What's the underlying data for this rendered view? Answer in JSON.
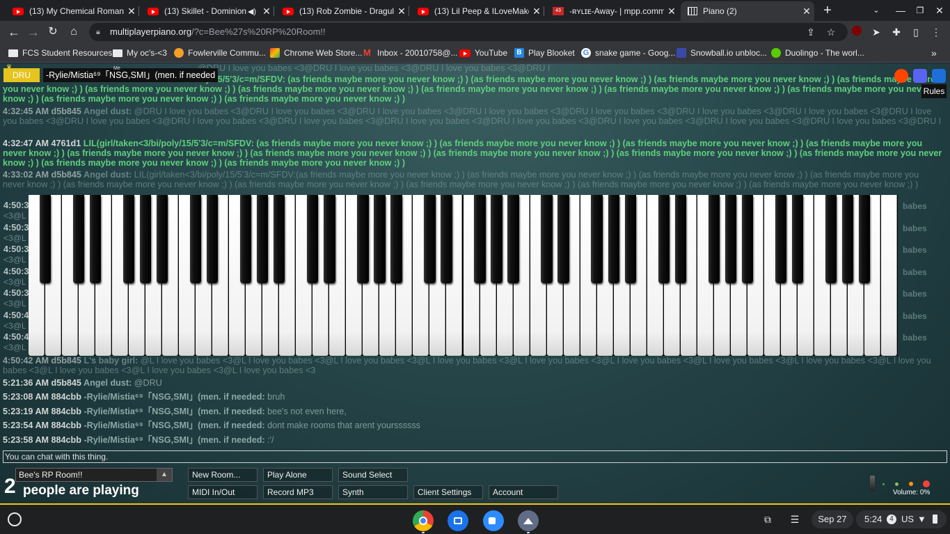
{
  "tabs": [
    {
      "title": "(13) My Chemical Romance",
      "icon": "youtube-icon"
    },
    {
      "title": "(13) Skillet - Dominion [",
      "icon": "youtube-icon",
      "audio": true
    },
    {
      "title": "(13) Rob Zombie - Dragula -",
      "icon": "youtube-icon"
    },
    {
      "title": "(13) Lil Peep & ILoveMakonn",
      "icon": "youtube-icon"
    },
    {
      "title": "-ʀʏʟɪᴇ-Away- | mpp.commu",
      "icon": "mpp-icon",
      "badge": "43"
    },
    {
      "title": "Piano (2)",
      "icon": "piano-icon",
      "active": true
    }
  ],
  "new_tab_symbol": "+",
  "address": {
    "host": "multiplayerpiano.org",
    "path": "/?c=Bee%27s%20RP%20Room!!"
  },
  "bookmarks": [
    {
      "label": "FCS Student Resources",
      "type": "folder"
    },
    {
      "label": "My oc's-<3",
      "type": "folder"
    },
    {
      "label": "Fowlerville Commu...",
      "type": "site",
      "color": "#f29e28"
    },
    {
      "label": "Chrome Web Store...",
      "type": "site",
      "color": "#ea4335"
    },
    {
      "label": "Inbox - 20010758@...",
      "type": "gmail",
      "color": "#ea4335"
    },
    {
      "label": "YouTube",
      "type": "youtube",
      "color": "#ff0000"
    },
    {
      "label": "Play Blooket",
      "type": "site",
      "color": "#1e88e5"
    },
    {
      "label": "snake game - Goog...",
      "type": "google",
      "color": "#4285f4"
    },
    {
      "label": "Snowball.io unbloc...",
      "type": "site",
      "color": "#3949ab"
    },
    {
      "label": "Duolingo - The worl...",
      "type": "site",
      "color": "#58cc02"
    }
  ],
  "bookmarks_overflow": "»",
  "page": {
    "name_badge": "DRU",
    "user_label": "-Rylie/Mistia⁶⁹「NSG,SMI」(men. if needed",
    "user_sub": "Me",
    "rules_label": "Rules",
    "messages": [
      {
        "time": "",
        "id": "",
        "name": "",
        "text": "@DRU I love you babes <3@DRU I love you babes <3@DRU I love you babes <3@DRU I",
        "green": false,
        "dim": true
      },
      {
        "time": "",
        "id": "",
        "name": "oly/15/5'3/c=m/SFDV:",
        "text": "(as friends maybe more you never know ;) ) (as friends maybe more you never know ;) ) (as friends maybe more you never know ;) ) (as friends maybe more you never know ;) ) (as friends more you never know ;) ) (as friends maybe more you never know ;) ) (as friends maybe more you never know ;) ) (as friends maybe more you never know ;) ) (as friends maybe more you never know ;) ) (as friends maybe more you never know ;) ) (as friends maybe more you never know ;) )",
        "green": true,
        "dim": true
      },
      {
        "time": "4:32:45 AM",
        "id": "d5b845",
        "name": "Angel dust:",
        "text": "@DRU I love you babes <3@DRU I love you babes <3@DRU I love you babes <3@DRU I love you babes <3@DRU I love you babes <3@DRU I love you babes <3@DRU I love you babes <3@DRU I love you babes <3@DRU I love you babes <3@DRU I love you babes <3@DRU I love you babes <3@DRU I love you babes <3@DRU I love you babes <3@DRU I love you babes <3@DRU I love you babes <3@DRU I love you babes <3@DRU I",
        "green": false,
        "dim": true
      },
      {
        "time": "4:32:47 AM",
        "id": "4761d1",
        "name": "LIL(girl/taken<3/bi/poly/15/5'3/c=m/SFDV:",
        "text": "(as friends maybe more you never know ;) ) (as friends maybe more you never know ;) ) (as friends maybe more you never know ;) ) (as friends maybe more you never know ;) ) (as friends maybe more you never know ;) ) (as friends maybe more you never know ;) ) (as friends maybe more you never know ;) ) (as friends maybe more you never know ;) ) (as friends maybe more you never know ;) ) (as friends maybe more you never know ;) ) (as friends maybe more you never know ;) )",
        "green": true,
        "dim": false
      },
      {
        "time": "4:33:02 AM",
        "id": "d5b845",
        "name": "Angel dust:",
        "text": "LIL(girl/taken<3/bi/poly/15/5'3/c=m/SFDV:(as friends maybe more you never know ;) ) (as friends maybe more you never know ;) ) (as friends maybe more you never know ;) ) (as friends maybe more you never know ;) ) (as friends maybe more you never know ;) ) (as friends maybe more you never know ;) ) (as friends maybe more you never know ;) ) (as friends maybe more you never know ;) ) (as friends maybe more you never know ;) )",
        "green": false,
        "dim": true
      },
      {
        "time": "4:50:42 AM",
        "id": "d5b845",
        "name": "L's baby girl:",
        "text": "@L I love you babes <3@L I love you babes <3@L I love you babes <3@L I love you babes <3@L I love you babes <3@L I love you babes <3@L I love you babes <3@L I love you babes <3@L I love you babes <3@L I love you babes <3@L I love you babes <3@L I love you babes <3",
        "green": false,
        "dim": true
      },
      {
        "time": "5:21:36 AM",
        "id": "d5b845",
        "name": "Angel dust:",
        "text": "@DRU",
        "green": false,
        "dim": false
      },
      {
        "time": "5:23:08 AM",
        "id": "884cbb",
        "name": "-Rylie/Mistia⁶⁹「NSG,SMI」(men. if needed:",
        "text": "bruh",
        "green": false,
        "dim": false
      },
      {
        "time": "5:23:19 AM",
        "id": "884cbb",
        "name": "-Rylie/Mistia⁶⁹「NSG,SMI」(men. if needed:",
        "text": "bee's not even here,",
        "green": false,
        "dim": false
      },
      {
        "time": "5:23:54 AM",
        "id": "884cbb",
        "name": "-Rylie/Mistia⁶⁹「NSG,SMI」(men. if needed:",
        "text": "dont make rooms that arent yourssssss",
        "green": false,
        "dim": false
      },
      {
        "time": "5:23:58 AM",
        "id": "884cbb",
        "name": "-Rylie/Mistia⁶⁹「NSG,SMI」(men. if needed:",
        "text": ":'/",
        "green": false,
        "dim": false
      }
    ],
    "partial_times": [
      "4:50:3",
      "4:50:3",
      "4:50:3",
      "4:50:3",
      "4:50:3",
      "4:50:4",
      "4:50:4"
    ],
    "partial_fragments": [
      "<3@L",
      "<3@L",
      "<3@L",
      "<3@L",
      "<3@L",
      "<3@L",
      "<3@L"
    ],
    "side_babes": [
      "babes",
      "babes",
      "babes",
      "babes",
      "babes",
      "babes",
      "babes"
    ],
    "chat_input_placeholder": "You can chat with this thing.",
    "room_name": "Bee's RP Room!!",
    "people_count": "2",
    "people_label": "people are playing",
    "buttons_row1": [
      "New Room...",
      "Play Alone",
      "Sound Select"
    ],
    "buttons_row2": [
      "MIDI In/Out",
      "Record MP3",
      "Synth",
      "Client Settings",
      "Account"
    ],
    "volume_label": "Volume: 0%"
  },
  "shelf": {
    "date": "Sep 27",
    "time": "5:24",
    "notif_count": "4",
    "locale": "US"
  }
}
